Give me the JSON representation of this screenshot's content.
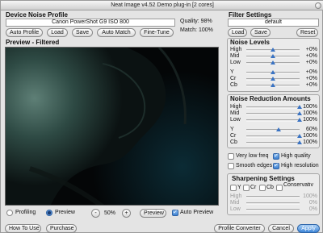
{
  "title": "Neat Image v4.52 Demo plug-in [2 cores]",
  "profile": {
    "heading": "Device Noise Profile",
    "device_name": "Canon PowerShot G9 ISO 800",
    "quality": "Quality: 98%",
    "match": "Match: 100%",
    "buttons": [
      "Auto Profile",
      "Load",
      "Save",
      "Auto Match",
      "Fine-Tune"
    ]
  },
  "preview": {
    "heading": "Preview - Filtered",
    "mode_profiling": "Profiling",
    "mode_preview": "Preview",
    "selected_mode": "Preview",
    "zoom_minus": "-",
    "zoom": "50%",
    "zoom_plus": "+",
    "preview_button": "Preview",
    "auto_preview_label": "Auto Preview",
    "auto_preview": true
  },
  "filter": {
    "heading": "Filter Settings",
    "preset": "default",
    "load": "Load",
    "save": "Save",
    "reset": "Reset",
    "noise_levels": {
      "title": "Noise Levels",
      "rows": [
        {
          "label": "High",
          "value": "+0%",
          "level": 0.5
        },
        {
          "label": "Mid",
          "value": "+0%",
          "level": 0.5
        },
        {
          "label": "Low",
          "value": "+0%",
          "level": 0.5
        },
        {
          "label": "Y",
          "value": "+0%",
          "level": 0.5
        },
        {
          "label": "Cr",
          "value": "+0%",
          "level": 0.5
        },
        {
          "label": "Cb",
          "value": "+0%",
          "level": 0.5
        }
      ]
    },
    "noise_reduction": {
      "title": "Noise Reduction Amounts",
      "rows": [
        {
          "label": "High",
          "value": "100%",
          "level": 1.0
        },
        {
          "label": "Mid",
          "value": "100%",
          "level": 1.0
        },
        {
          "label": "Low",
          "value": "100%",
          "level": 1.0
        },
        {
          "label": "Y",
          "value": "60%",
          "level": 0.6
        },
        {
          "label": "Cr",
          "value": "100%",
          "level": 1.0
        },
        {
          "label": "Cb",
          "value": "100%",
          "level": 1.0
        }
      ]
    },
    "options": {
      "very_low_freq": {
        "label": "Very low freq",
        "checked": false
      },
      "high_quality": {
        "label": "High quality",
        "checked": true
      },
      "smooth_edges": {
        "label": "Smooth edges",
        "checked": false
      },
      "high_resolution": {
        "label": "High resolution",
        "checked": true
      }
    },
    "sharpening": {
      "title": "Sharpening Settings",
      "channels": [
        "Y",
        "Cr",
        "Cb"
      ],
      "conservative": "Conservativ",
      "rows": [
        {
          "label": "High",
          "value": "100%"
        },
        {
          "label": "Mid",
          "value": "0%"
        },
        {
          "label": "Low",
          "value": "0%"
        }
      ]
    }
  },
  "footer": {
    "how_to_use": "How To Use",
    "purchase": "Purchase",
    "profile_converter": "Profile Converter",
    "cancel": "Cancel",
    "apply": "Apply"
  },
  "colors": {
    "accent": "#3c7fd0",
    "window_bg": "#e4e4e4"
  }
}
